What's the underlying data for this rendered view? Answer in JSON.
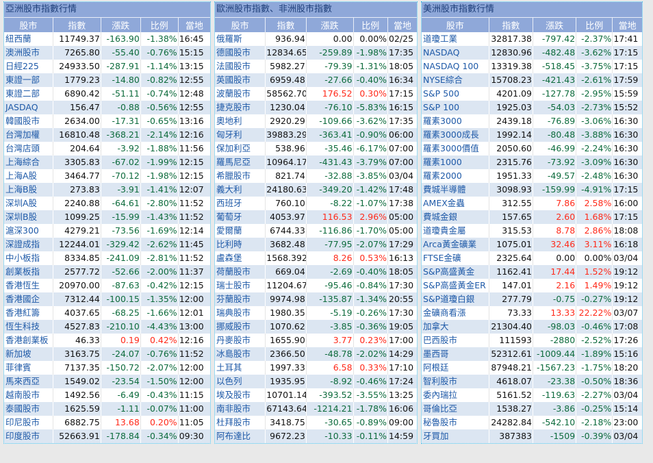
{
  "colors": {
    "title_bar": "#8fa8d9",
    "title_text": "#1f3f7a",
    "name": "#1f5aa8",
    "down": "#0d6b3c",
    "up": "#ff2a1a",
    "flat": "#111111",
    "alt_row": "#dce6f2"
  },
  "columns": [
    "股市",
    "指數",
    "漲跌",
    "比例",
    "當地"
  ],
  "panels": [
    {
      "title": "亞洲股市指數行情",
      "rows": [
        [
          "紐西蘭",
          "11749.37",
          "-163.90",
          "-1.38%",
          "16:45"
        ],
        [
          "澳洲股市",
          "7265.80",
          "-55.40",
          "-0.76%",
          "15:15"
        ],
        [
          "日經225",
          "24933.50",
          "-287.91",
          "-1.14%",
          "13:15"
        ],
        [
          "東證一部",
          "1779.23",
          "-14.80",
          "-0.82%",
          "12:55"
        ],
        [
          "東證二部",
          "6890.42",
          "-51.11",
          "-0.74%",
          "12:48"
        ],
        [
          "JASDAQ",
          "156.47",
          "-0.88",
          "-0.56%",
          "12:55"
        ],
        [
          "韓國股市",
          "2634.00",
          "-17.31",
          "-0.65%",
          "13:16"
        ],
        [
          "台灣加權",
          "16810.48",
          "-368.21",
          "-2.14%",
          "12:16"
        ],
        [
          "台灣店頭",
          "204.64",
          "-3.92",
          "-1.88%",
          "11:56"
        ],
        [
          "上海綜合",
          "3305.83",
          "-67.02",
          "-1.99%",
          "12:15"
        ],
        [
          "上海A股",
          "3464.77",
          "-70.12",
          "-1.98%",
          "12:15"
        ],
        [
          "上海B股",
          "273.83",
          "-3.91",
          "-1.41%",
          "12:07"
        ],
        [
          "深圳A股",
          "2240.88",
          "-64.61",
          "-2.80%",
          "11:52"
        ],
        [
          "深圳B股",
          "1099.25",
          "-15.99",
          "-1.43%",
          "11:52"
        ],
        [
          "滬深300",
          "4279.21",
          "-73.56",
          "-1.69%",
          "12:14"
        ],
        [
          "深證成指",
          "12244.01",
          "-329.42",
          "-2.62%",
          "11:45"
        ],
        [
          "中小板指",
          "8334.85",
          "-241.09",
          "-2.81%",
          "11:52"
        ],
        [
          "創業板指",
          "2577.72",
          "-52.66",
          "-2.00%",
          "11:37"
        ],
        [
          "香港恆生",
          "20970.00",
          "-87.63",
          "-0.42%",
          "12:15"
        ],
        [
          "香港國企",
          "7312.44",
          "-100.15",
          "-1.35%",
          "12:00"
        ],
        [
          "香港紅籌",
          "4037.65",
          "-68.25",
          "-1.66%",
          "12:01"
        ],
        [
          "恆生科技",
          "4527.83",
          "-210.10",
          "-4.43%",
          "13:00"
        ],
        [
          "香港創業板",
          "46.33",
          "0.19",
          "0.42%",
          "12:16"
        ],
        [
          "新加坡",
          "3163.75",
          "-24.07",
          "-0.76%",
          "11:52"
        ],
        [
          "菲律賓",
          "7137.35",
          "-150.72",
          "-2.07%",
          "12:00"
        ],
        [
          "馬來西亞",
          "1549.02",
          "-23.54",
          "-1.50%",
          "12:00"
        ],
        [
          "越南股市",
          "1492.56",
          "-6.49",
          "-0.43%",
          "11:15"
        ],
        [
          "泰國股市",
          "1625.59",
          "-1.11",
          "-0.07%",
          "11:00"
        ],
        [
          "印尼股市",
          "6882.75",
          "13.68",
          "0.20%",
          "11:05"
        ],
        [
          "印度股市",
          "52663.91",
          "-178.84",
          "-0.34%",
          "09:30"
        ]
      ]
    },
    {
      "title": "歐洲股市指數、非洲股市指數",
      "rows": [
        [
          "俄羅斯",
          "936.94",
          "0.00",
          "0.00%",
          "02/25"
        ],
        [
          "德國股市",
          "12834.65",
          "-259.89",
          "-1.98%",
          "17:35"
        ],
        [
          "法國股市",
          "5982.27",
          "-79.39",
          "-1.31%",
          "18:05"
        ],
        [
          "英國股市",
          "6959.48",
          "-27.66",
          "-0.40%",
          "16:34"
        ],
        [
          "波蘭股市",
          "58562.70",
          "176.52",
          "0.30%",
          "17:15"
        ],
        [
          "捷克股市",
          "1230.04",
          "-76.10",
          "-5.83%",
          "16:15"
        ],
        [
          "奧地利",
          "2920.29",
          "-109.66",
          "-3.62%",
          "17:35"
        ],
        [
          "匈牙利",
          "39883.29",
          "-363.41",
          "-0.90%",
          "06:00"
        ],
        [
          "保加利亞",
          "538.96",
          "-35.46",
          "-6.17%",
          "07:00"
        ],
        [
          "羅馬尼亞",
          "10964.17",
          "-431.43",
          "-3.79%",
          "07:00"
        ],
        [
          "希臘股市",
          "821.74",
          "-32.88",
          "-3.85%",
          "03/04"
        ],
        [
          "義大利",
          "24180.63",
          "-349.20",
          "-1.42%",
          "17:48"
        ],
        [
          "西班牙",
          "760.10",
          "-8.22",
          "-1.07%",
          "17:38"
        ],
        [
          "葡萄牙",
          "4053.97",
          "116.53",
          "2.96%",
          "05:00"
        ],
        [
          "愛爾蘭",
          "6744.33",
          "-116.86",
          "-1.70%",
          "05:00"
        ],
        [
          "比利時",
          "3682.48",
          "-77.95",
          "-2.07%",
          "17:29"
        ],
        [
          "盧森堡",
          "1568.392",
          "8.26",
          "0.53%",
          "16:13"
        ],
        [
          "荷蘭股市",
          "669.04",
          "-2.69",
          "-0.40%",
          "18:05"
        ],
        [
          "瑞士股市",
          "11204.67",
          "-95.46",
          "-0.84%",
          "17:30"
        ],
        [
          "芬蘭股市",
          "9974.98",
          "-135.87",
          "-1.34%",
          "20:55"
        ],
        [
          "瑞典股市",
          "1980.35",
          "-5.19",
          "-0.26%",
          "17:30"
        ],
        [
          "挪威股市",
          "1070.62",
          "-3.85",
          "-0.36%",
          "19:05"
        ],
        [
          "丹麥股市",
          "1655.90",
          "3.77",
          "0.23%",
          "17:00"
        ],
        [
          "冰島股市",
          "2366.50",
          "-48.78",
          "-2.02%",
          "14:29"
        ],
        [
          "土耳其",
          "1997.33",
          "6.58",
          "0.33%",
          "17:10"
        ],
        [
          "以色列",
          "1935.95",
          "-8.92",
          "-0.46%",
          "17:24"
        ],
        [
          "埃及股市",
          "10701.14",
          "-393.52",
          "-3.55%",
          "13:25"
        ],
        [
          "南非股市",
          "67143.64",
          "-1214.21",
          "-1.78%",
          "16:06"
        ],
        [
          "杜拜股市",
          "3418.75",
          "-30.65",
          "-0.89%",
          "09:00"
        ],
        [
          "阿布達比",
          "9672.23",
          "-10.33",
          "-0.11%",
          "14:59"
        ]
      ]
    },
    {
      "title": "美洲股市指數行情",
      "rows": [
        [
          "道瓊工業",
          "32817.38",
          "-797.42",
          "-2.37%",
          "17:41"
        ],
        [
          "NASDAQ",
          "12830.96",
          "-482.48",
          "-3.62%",
          "17:15"
        ],
        [
          "NASDAQ 100",
          "13319.38",
          "-518.45",
          "-3.75%",
          "17:15"
        ],
        [
          "NYSE綜合",
          "15708.23",
          "-421.43",
          "-2.61%",
          "17:59"
        ],
        [
          "S&P 500",
          "4201.09",
          "-127.78",
          "-2.95%",
          "15:59"
        ],
        [
          "S&P 100",
          "1925.03",
          "-54.03",
          "-2.73%",
          "15:52"
        ],
        [
          "羅素3000",
          "2439.18",
          "-76.89",
          "-3.06%",
          "16:30"
        ],
        [
          "羅素3000成長",
          "1992.14",
          "-80.48",
          "-3.88%",
          "16:30"
        ],
        [
          "羅素3000價值",
          "2050.60",
          "-46.99",
          "-2.24%",
          "16:30"
        ],
        [
          "羅素1000",
          "2315.76",
          "-73.92",
          "-3.09%",
          "16:30"
        ],
        [
          "羅素2000",
          "1951.33",
          "-49.57",
          "-2.48%",
          "16:30"
        ],
        [
          "費城半導體",
          "3098.93",
          "-159.99",
          "-4.91%",
          "17:15"
        ],
        [
          "AMEX金蟲",
          "312.55",
          "7.86",
          "2.58%",
          "16:00"
        ],
        [
          "費城金銀",
          "157.65",
          "2.60",
          "1.68%",
          "17:15"
        ],
        [
          "道瓊貴金屬",
          "315.53",
          "8.78",
          "2.86%",
          "18:08"
        ],
        [
          "Arca黃金礦業",
          "1075.01",
          "32.46",
          "3.11%",
          "16:18"
        ],
        [
          "FTSE金礦",
          "2325.64",
          "0.00",
          "0.00%",
          "03/04"
        ],
        [
          "S&P高盛黃金",
          "1162.41",
          "17.44",
          "1.52%",
          "19:12"
        ],
        [
          "S&P高盛黃金ER",
          "147.01",
          "2.16",
          "1.49%",
          "19:12"
        ],
        [
          "S&P道瓊白銀",
          "277.79",
          "-0.75",
          "-0.27%",
          "19:12"
        ],
        [
          "金礦商看漲",
          "73.33",
          "13.33",
          "22.22%",
          "03/07"
        ],
        [
          "加拿大",
          "21304.40",
          "-98.03",
          "-0.46%",
          "17:08"
        ],
        [
          "巴西股市",
          "111593",
          "-2880",
          "-2.52%",
          "17:26"
        ],
        [
          "墨西哥",
          "52312.61",
          "-1009.44",
          "-1.89%",
          "15:16"
        ],
        [
          "阿根廷",
          "87948.21",
          "-1567.23",
          "-1.75%",
          "18:20"
        ],
        [
          "智利股市",
          "4618.07",
          "-23.38",
          "-0.50%",
          "18:36"
        ],
        [
          "委內瑞拉",
          "5161.52",
          "-119.63",
          "-2.27%",
          "03/04"
        ],
        [
          "哥倫比亞",
          "1538.27",
          "-3.86",
          "-0.25%",
          "15:14"
        ],
        [
          "秘魯股市",
          "24282.84",
          "-542.10",
          "-2.18%",
          "23:00"
        ],
        [
          "牙買加",
          "387383",
          "-1509",
          "-0.39%",
          "03/04"
        ]
      ]
    }
  ]
}
